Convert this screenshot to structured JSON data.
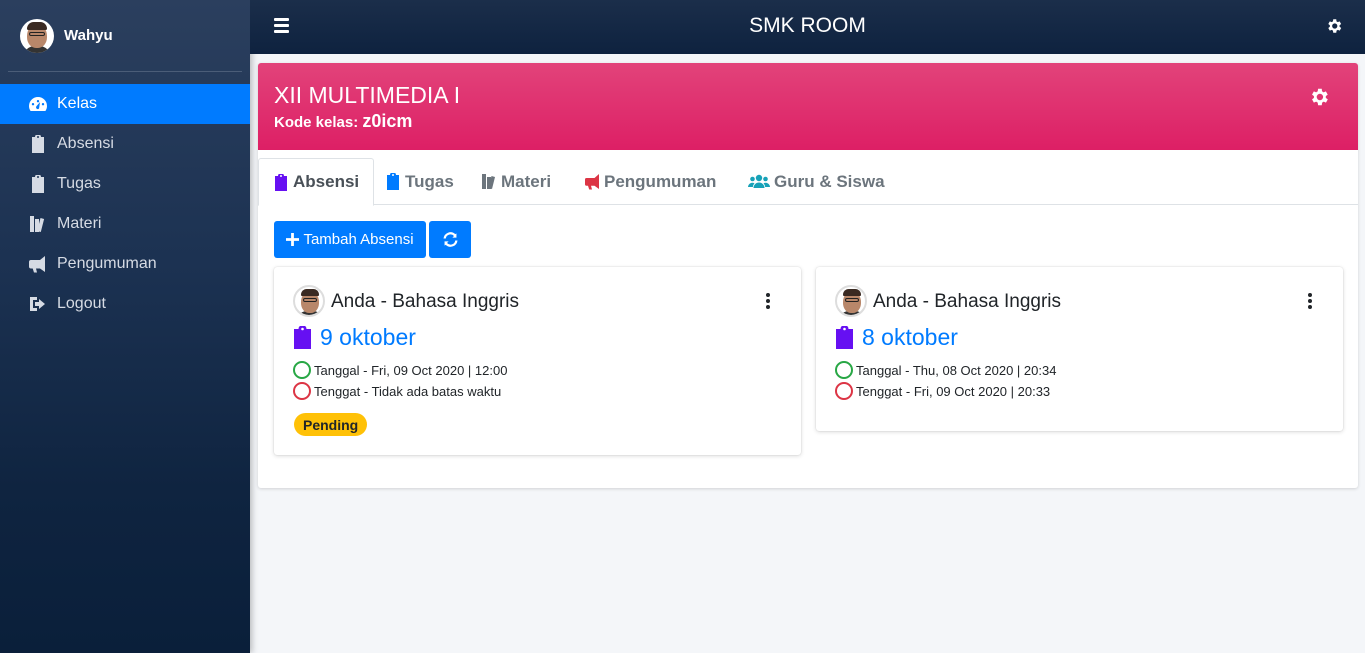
{
  "sidebar": {
    "user_name": "Wahyu",
    "items": [
      {
        "label": "Kelas",
        "icon": "tachometer-icon",
        "active": true
      },
      {
        "label": "Absensi",
        "icon": "clipboard-check-icon"
      },
      {
        "label": "Tugas",
        "icon": "clipboard-list-icon"
      },
      {
        "label": "Materi",
        "icon": "book-icon"
      },
      {
        "label": "Pengumuman",
        "icon": "bullhorn-icon"
      },
      {
        "label": "Logout",
        "icon": "sign-out-icon"
      }
    ]
  },
  "topbar": {
    "title": "SMK ROOM"
  },
  "class": {
    "name": "XII MULTIMEDIA I",
    "code_label": "Kode kelas:",
    "code_value": "z0icm"
  },
  "tabs": [
    {
      "label": "Absensi",
      "icon": "clipboard-check-icon",
      "color": "#6610f2",
      "active": true
    },
    {
      "label": "Tugas",
      "icon": "clipboard-list-icon",
      "color": "#007bff"
    },
    {
      "label": "Materi",
      "icon": "book-icon",
      "color": "#6c757d"
    },
    {
      "label": "Pengumuman",
      "icon": "bullhorn-icon",
      "color": "#dc3545"
    },
    {
      "label": "Guru & Siswa",
      "icon": "users-icon",
      "color": "#17a2b8"
    }
  ],
  "actions": {
    "add_label": "Tambah Absensi"
  },
  "absensi": [
    {
      "author": "Anda - Bahasa Inggris",
      "title": "9 oktober",
      "tanggal": "Tanggal - Fri, 09 Oct 2020 | 12:00",
      "tenggat": "Tenggat - Tidak ada batas waktu",
      "status": "Pending"
    },
    {
      "author": "Anda - Bahasa Inggris",
      "title": "8 oktober",
      "tanggal": "Tanggal - Thu, 08 Oct 2020 | 20:34",
      "tenggat": "Tenggat - Fri, 09 Oct 2020 | 20:33"
    }
  ],
  "colors": {
    "primary": "#007bff",
    "header_pink": "#dd1f65",
    "sidebar_dark": "#0f2440",
    "badge_pending": "#ffc107"
  }
}
